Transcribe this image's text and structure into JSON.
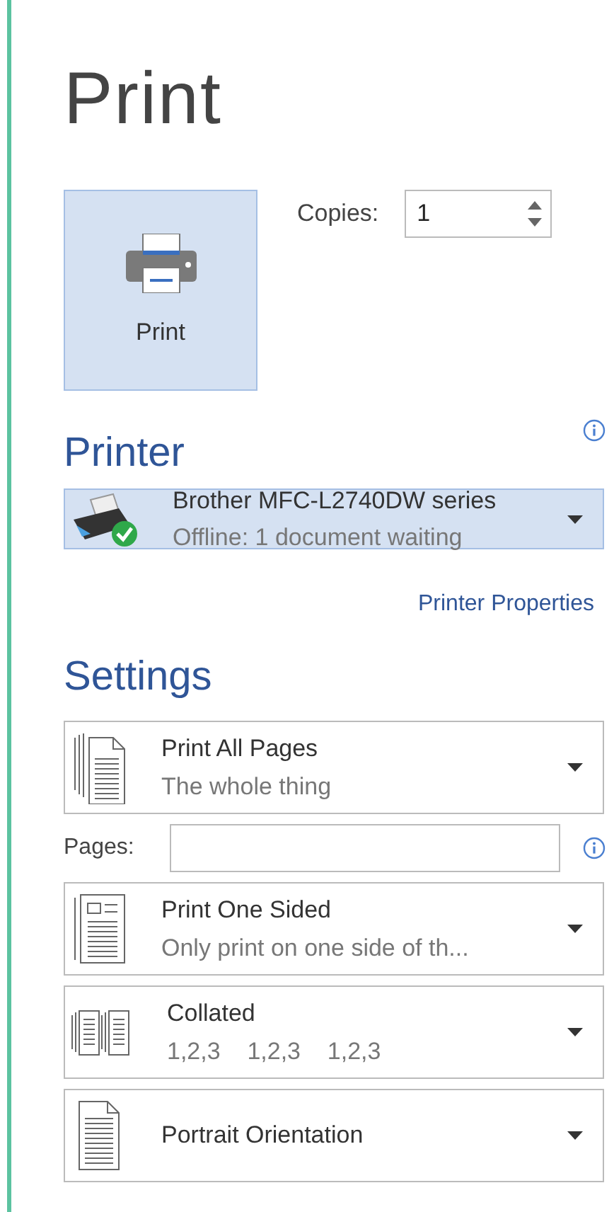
{
  "title": "Print",
  "print_button": {
    "label": "Print"
  },
  "copies": {
    "label": "Copies:",
    "value": "1"
  },
  "printer": {
    "heading": "Printer",
    "name": "Brother MFC-L2740DW series",
    "status": "Offline: 1 document waiting",
    "selected": true,
    "properties_link": "Printer Properties"
  },
  "settings": {
    "heading": "Settings",
    "items": [
      {
        "kind": "pages-range",
        "title": "Print All Pages",
        "subtitle": "The whole thing"
      },
      {
        "kind": "pages-field",
        "label": "Pages:"
      },
      {
        "kind": "sides",
        "title": "Print One Sided",
        "subtitle": "Only print on one side of th..."
      },
      {
        "kind": "collation",
        "title": "Collated",
        "subtitle": "1,2,3    1,2,3    1,2,3"
      },
      {
        "kind": "orientation",
        "title": "Portrait Orientation"
      }
    ]
  }
}
